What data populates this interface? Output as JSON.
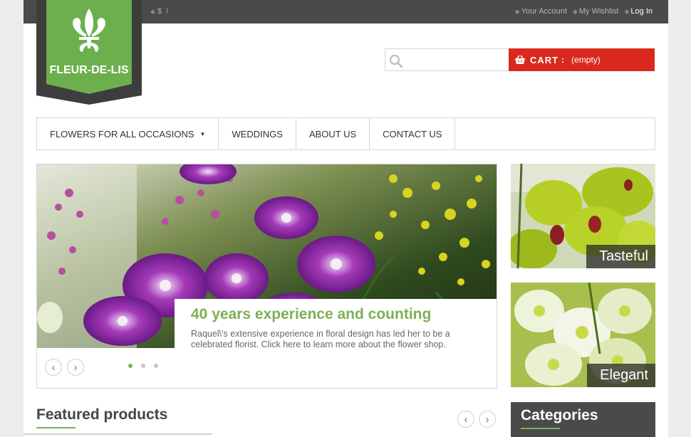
{
  "topbar": {
    "currency": "$",
    "separator": "/",
    "links": {
      "account": "Your Account",
      "wishlist": "My Wishlist",
      "login": "Log In"
    }
  },
  "logo": {
    "text": "FLEUR-DE-LIS"
  },
  "search": {
    "placeholder": "",
    "value": ""
  },
  "cart": {
    "label": "CART",
    "colon": ":",
    "status": "(empty)"
  },
  "nav": {
    "items": [
      {
        "label": "FLOWERS FOR ALL OCCASIONS",
        "has_dropdown": true
      },
      {
        "label": "WEDDINGS"
      },
      {
        "label": "ABOUT US"
      },
      {
        "label": "CONTACT US"
      }
    ]
  },
  "slider": {
    "title": "40 years experience and counting",
    "text": "Raquel\\'s extensive experience in floral design has led her to be a celebrated florist. Click here to learn more about the flower shop.",
    "prev_icon": "‹",
    "next_icon": "›",
    "dots": 3,
    "active_dot": 1
  },
  "banners": [
    {
      "label": "Tasteful"
    },
    {
      "label": "Elegant"
    }
  ],
  "featured": {
    "title": "Featured products",
    "prev_icon": "‹",
    "next_icon": "›"
  },
  "categories": {
    "title": "Categories"
  },
  "colors": {
    "green": "#7cb055",
    "red": "#d9291f",
    "dark": "#4a4a4a"
  }
}
